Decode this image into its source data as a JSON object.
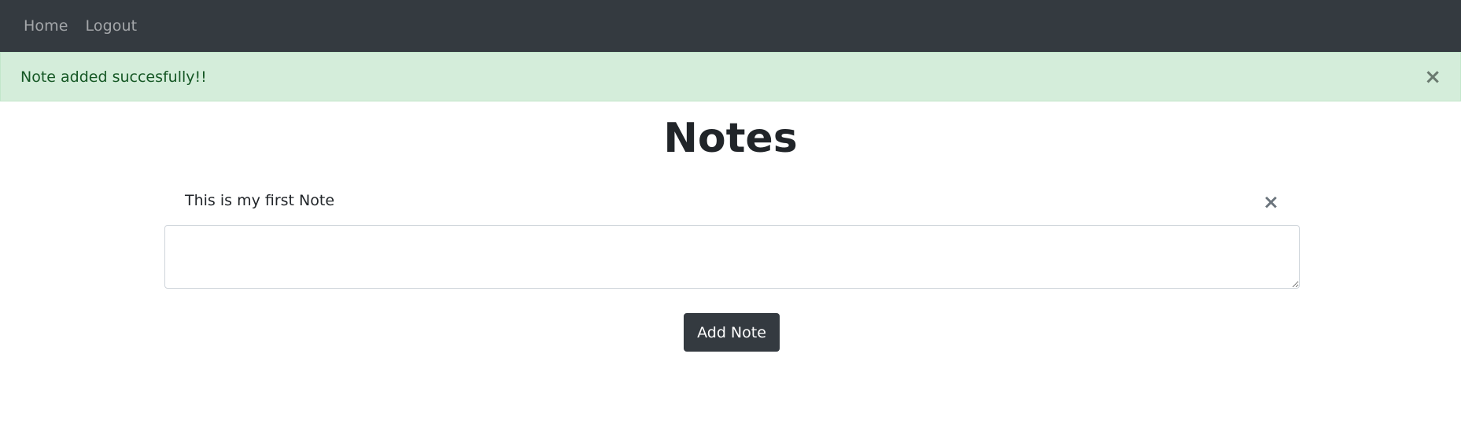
{
  "navbar": {
    "links": [
      {
        "label": "Home"
      },
      {
        "label": "Logout"
      }
    ],
    "background_color": "#343a40"
  },
  "alert": {
    "message": "Note added succesfully!!",
    "close_icon": "×",
    "background_color": "#d4edda",
    "text_color": "#155724"
  },
  "main": {
    "title": "Notes",
    "notes": [
      {
        "text": "This is my first Note",
        "delete_icon": "×"
      }
    ],
    "note_input": {
      "value": "",
      "placeholder": ""
    },
    "add_button_label": "Add Note"
  }
}
